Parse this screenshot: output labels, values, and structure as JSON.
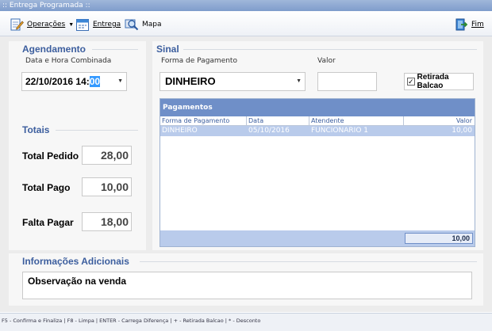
{
  "window": {
    "title": ":: Entrega Programada ::"
  },
  "toolbar": {
    "operacoes": "Operações",
    "entrega": "Entrega",
    "mapa": "Mapa",
    "fim": "Fim"
  },
  "agendamento": {
    "title": "Agendamento",
    "label": "Data e Hora Combinada",
    "value_prefix": "22/10/2016 14:",
    "value_selected": "00"
  },
  "totais": {
    "title": "Totais",
    "total_pedido_label": "Total Pedido",
    "total_pedido_value": "28,00",
    "total_pago_label": "Total Pago",
    "total_pago_value": "10,00",
    "falta_pagar_label": "Falta Pagar",
    "falta_pagar_value": "18,00"
  },
  "sinal": {
    "title": "Sinal",
    "forma_label": "Forma de Pagamento",
    "forma_value": "DINHEIRO",
    "valor_label": "Valor",
    "valor_value": "",
    "retirada_label": "Retirada Balcao",
    "retirada_checked": true
  },
  "pagamentos": {
    "title": "Pagamentos",
    "columns": [
      "Forma de Pagamento",
      "Data",
      "Atendente",
      "Valor"
    ],
    "rows": [
      [
        "DINHEIRO",
        "05/10/2016",
        "FUNCIONARIO 1",
        "10,00"
      ]
    ],
    "total": "10,00"
  },
  "informacoes": {
    "title": "Informações Adicionais",
    "text": "Observação na venda"
  },
  "status": {
    "text": "F5 - Confirma e Finaliza  |  F8 - Limpa  |  ENTER - Carrega Diferença  | + - Retirada Balcao  | * - Desconto"
  },
  "colors": {
    "title_bar": "#8aa6d2",
    "group_title": "#3c5e9e",
    "grid_header": "#6f8fc8",
    "selected_row": "#b9cbeb",
    "selection": "#3399ff"
  }
}
